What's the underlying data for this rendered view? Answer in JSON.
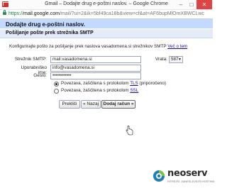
{
  "window": {
    "title": "Gmail – Dodajte drug e-poštni naslov. – Google Chrome",
    "url_scheme": "https://",
    "url_host": "mail.google.com",
    "url_path": "/mail/?ui=2&ik=5bf49ca18b&view=cf&at=AF6bupMlOmXBWCLwc"
  },
  "dialog": {
    "title": "Dodajte drug e-poštni naslov.",
    "section_title": "Pošiljanje pošte prek strežnika SMTP",
    "intro_text": "Konfigurirajte pošto za pošiljanje prek naslova vasadomena.si strežnikov SMTP",
    "intro_link": "Več o tem"
  },
  "form": {
    "smtp_label": "Strežnik SMTP:",
    "smtp_value": "mail.vasadomena.si",
    "port_label": "Vrata:",
    "port_value": "587",
    "username_label": "Uporabniško ime:",
    "username_value": "info@vasadomena.si",
    "password_label": "Geslo:",
    "password_value": "••••••••••••",
    "tls_option_text": "Povezava, zaščitena s protokolom",
    "tls_link": "TLS",
    "tls_suffix": "(priporočeno)",
    "ssl_option_text": "Povezava, zaščitena s protokolom",
    "ssl_link": "SSL",
    "selected_security": "TLS"
  },
  "buttons": {
    "cancel": "Prekliči",
    "back": "« Nazaj",
    "add_account": "Dodaj račun »"
  },
  "branding": {
    "logo_text": "neoserv",
    "logo_tagline": "HITREJŠI, ZANESLJIVEJŠI HOSTING"
  },
  "colors": {
    "header_bg": "#c3d9ff",
    "section_bg": "#e5ecf9",
    "link": "#1a0dab",
    "close_button": "#e04343"
  }
}
